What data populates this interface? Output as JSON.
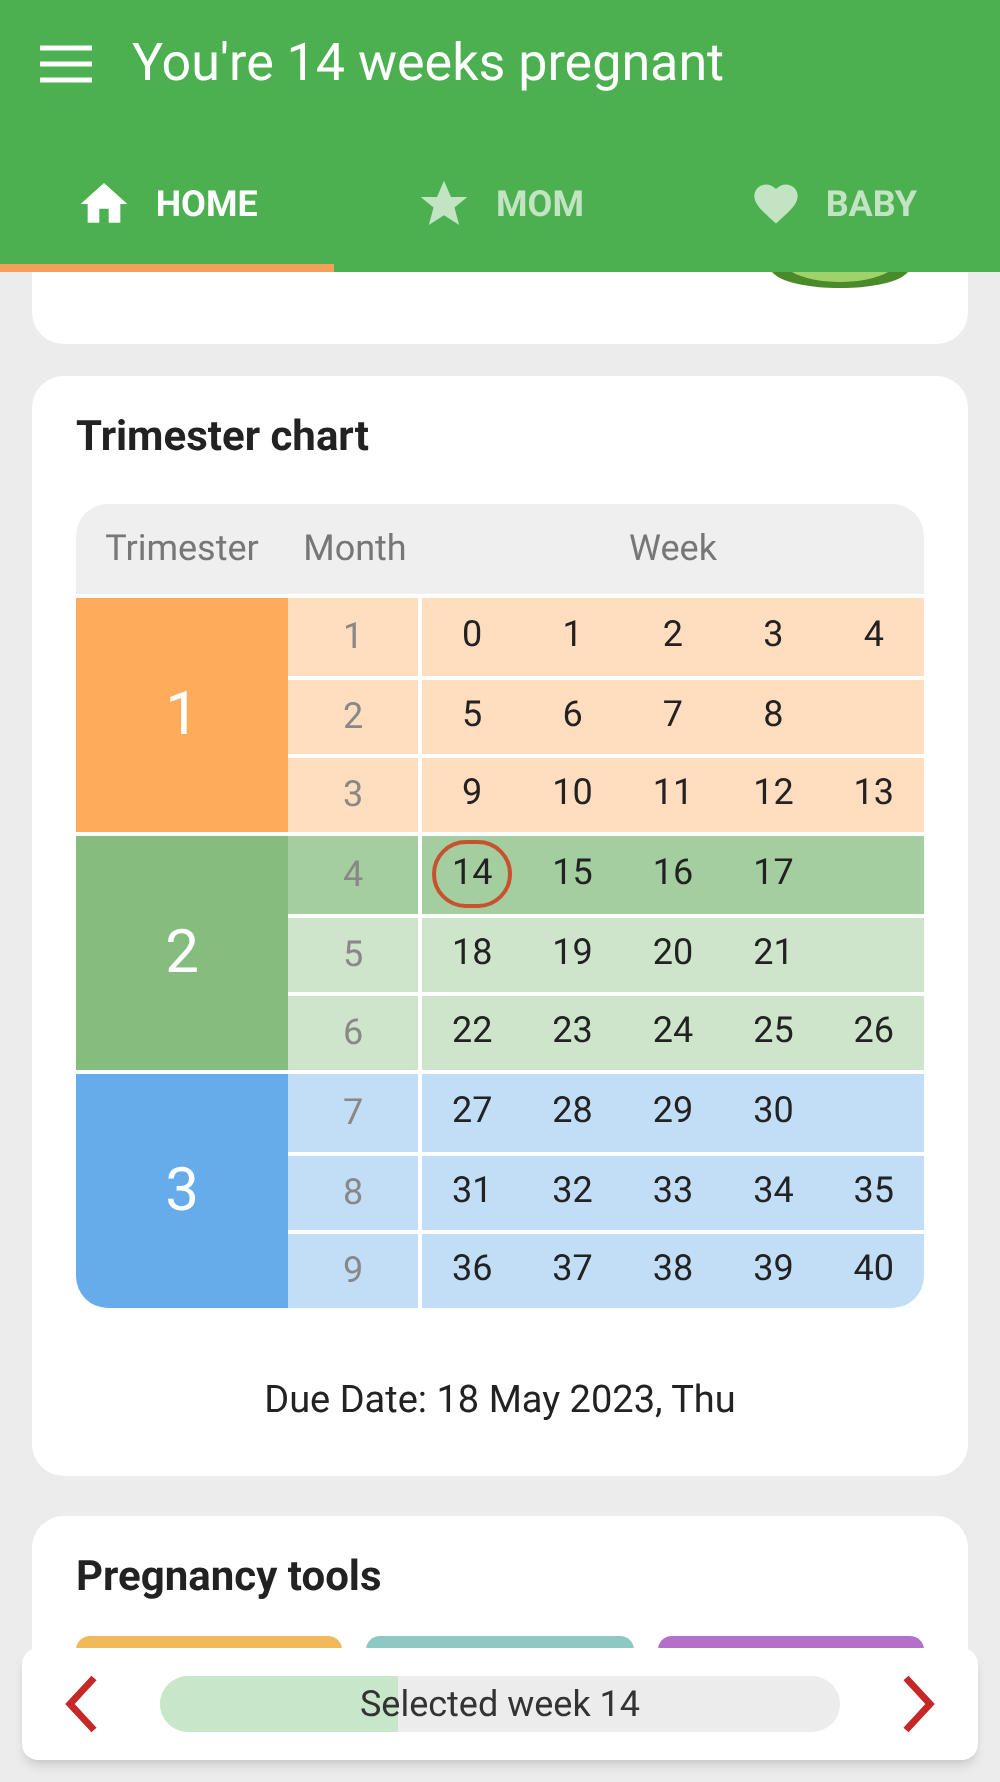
{
  "app_bar": {
    "title": "You're 14 weeks pregnant"
  },
  "tabs": [
    {
      "label": "HOME",
      "kind": "home",
      "selected": true
    },
    {
      "label": "MOM",
      "kind": "star",
      "selected": false
    },
    {
      "label": "BABY",
      "kind": "heart",
      "selected": false
    }
  ],
  "trimester_chart": {
    "title": "Trimester chart",
    "columns": [
      "Trimester",
      "Month",
      "Week"
    ],
    "trimesters": [
      {
        "label": "1",
        "color": "#ffab5c",
        "months": [
          {
            "label": "1",
            "current": false,
            "weeks": [
              {
                "label": "0",
                "selected": false
              },
              {
                "label": "1",
                "selected": false
              },
              {
                "label": "2",
                "selected": false
              },
              {
                "label": "3",
                "selected": false
              },
              {
                "label": "4",
                "selected": false
              }
            ]
          },
          {
            "label": "2",
            "current": false,
            "weeks": [
              {
                "label": "5",
                "selected": false
              },
              {
                "label": "6",
                "selected": false
              },
              {
                "label": "7",
                "selected": false
              },
              {
                "label": "8",
                "selected": false
              }
            ]
          },
          {
            "label": "3",
            "current": false,
            "weeks": [
              {
                "label": "9",
                "selected": false
              },
              {
                "label": "10",
                "selected": false
              },
              {
                "label": "11",
                "selected": false
              },
              {
                "label": "12",
                "selected": false
              },
              {
                "label": "13",
                "selected": false
              }
            ]
          }
        ]
      },
      {
        "label": "2",
        "color": "#85bd7f",
        "months": [
          {
            "label": "4",
            "current": true,
            "weeks": [
              {
                "label": "14",
                "selected": true
              },
              {
                "label": "15",
                "selected": false
              },
              {
                "label": "16",
                "selected": false
              },
              {
                "label": "17",
                "selected": false
              }
            ]
          },
          {
            "label": "5",
            "current": false,
            "weeks": [
              {
                "label": "18",
                "selected": false
              },
              {
                "label": "19",
                "selected": false
              },
              {
                "label": "20",
                "selected": false
              },
              {
                "label": "21",
                "selected": false
              }
            ]
          },
          {
            "label": "6",
            "current": false,
            "weeks": [
              {
                "label": "22",
                "selected": false
              },
              {
                "label": "23",
                "selected": false
              },
              {
                "label": "24",
                "selected": false
              },
              {
                "label": "25",
                "selected": false
              },
              {
                "label": "26",
                "selected": false
              }
            ]
          }
        ]
      },
      {
        "label": "3",
        "color": "#66acea",
        "months": [
          {
            "label": "7",
            "current": false,
            "weeks": [
              {
                "label": "27",
                "selected": false
              },
              {
                "label": "28",
                "selected": false
              },
              {
                "label": "29",
                "selected": false
              },
              {
                "label": "30",
                "selected": false
              }
            ]
          },
          {
            "label": "8",
            "current": false,
            "weeks": [
              {
                "label": "31",
                "selected": false
              },
              {
                "label": "32",
                "selected": false
              },
              {
                "label": "33",
                "selected": false
              },
              {
                "label": "34",
                "selected": false
              },
              {
                "label": "35",
                "selected": false
              }
            ]
          },
          {
            "label": "9",
            "current": false,
            "weeks": [
              {
                "label": "36",
                "selected": false
              },
              {
                "label": "37",
                "selected": false
              },
              {
                "label": "38",
                "selected": false
              },
              {
                "label": "39",
                "selected": false
              },
              {
                "label": "40",
                "selected": false
              }
            ]
          }
        ]
      }
    ],
    "due_date": "Due Date: 18 May 2023, Thu"
  },
  "tools": {
    "title": "Pregnancy tools",
    "tiles": [
      {
        "color": "#f0b95a"
      },
      {
        "color": "#8ec8c2"
      },
      {
        "color": "#b46fc8"
      }
    ]
  },
  "week_bar": {
    "label": "Selected week 14",
    "level": 0.35
  }
}
